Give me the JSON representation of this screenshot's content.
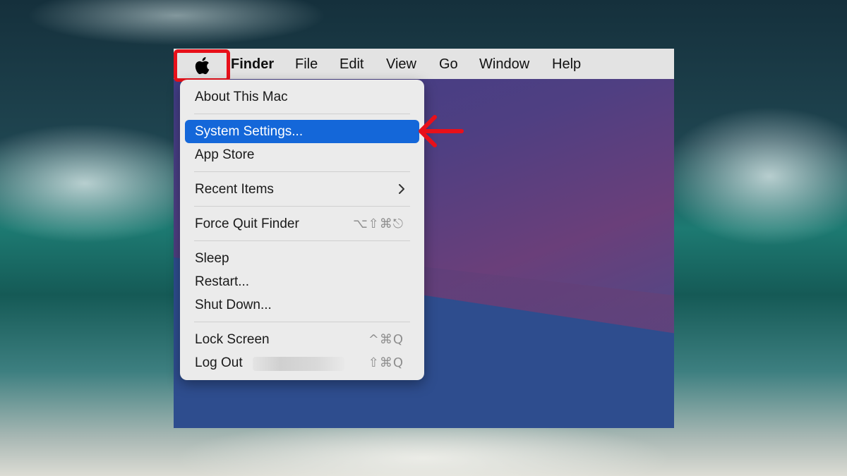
{
  "menubar": {
    "apple_icon": "apple-logo-icon",
    "items": [
      "Finder",
      "File",
      "Edit",
      "View",
      "Go",
      "Window",
      "Help"
    ]
  },
  "apple_menu": {
    "about": "About This Mac",
    "system_settings": "System Settings...",
    "app_store": "App Store",
    "recent_items": "Recent Items",
    "force_quit": "Force Quit Finder",
    "force_quit_shortcut": "⌥⇧⌘⎋",
    "sleep": "Sleep",
    "restart": "Restart...",
    "shut_down": "Shut Down...",
    "lock_screen": "Lock Screen",
    "lock_screen_shortcut": "^⌘Q",
    "log_out": "Log Out",
    "log_out_shortcut": "⇧⌘Q",
    "selected_item": "System Settings..."
  },
  "annotations": {
    "highlight_color": "#e8101a",
    "selection_color": "#1467d9"
  }
}
